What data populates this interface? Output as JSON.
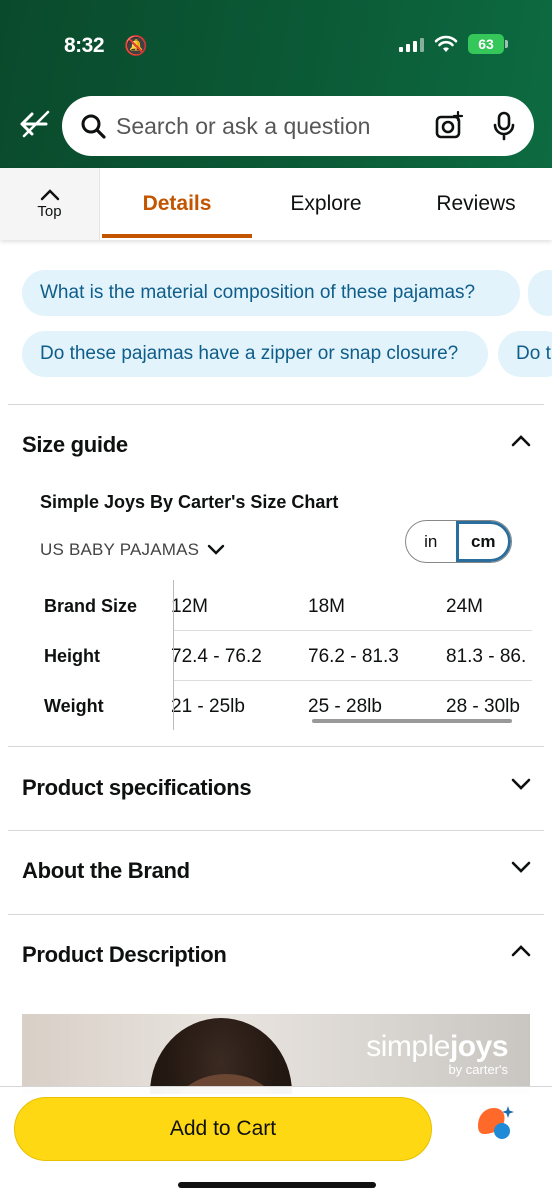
{
  "status_bar": {
    "time": "8:32",
    "battery": "63"
  },
  "search": {
    "placeholder": "Search or ask a question"
  },
  "tabs": {
    "top_label": "Top",
    "items": [
      "Details",
      "Explore",
      "Reviews"
    ],
    "active": "Details"
  },
  "questions": [
    "What is the material composition of these pajamas?",
    "Do these pajamas have a zipper or snap closure?",
    "Do t"
  ],
  "size_guide": {
    "title": "Size guide",
    "chart_title": "Simple Joys By Carter's Size Chart",
    "chart_category": "US BABY PAJAMAS",
    "units": [
      "in",
      "cm"
    ],
    "selected_unit": "cm",
    "rows": [
      {
        "label": "Brand Size",
        "cells": [
          "12M",
          "18M",
          "24M"
        ]
      },
      {
        "label": "Height",
        "cells": [
          "72.4 - 76.2",
          "76.2 - 81.3",
          "81.3 - 86."
        ]
      },
      {
        "label": "Weight",
        "cells": [
          "21 - 25lb",
          "25 - 28lb",
          "28 - 30lb"
        ]
      }
    ]
  },
  "sections": {
    "specs": "Product specifications",
    "brand": "About the Brand",
    "description": "Product Description"
  },
  "product_image": {
    "logo_line1_a": "simple",
    "logo_line1_b": "joys",
    "logo_line2": "by carter's"
  },
  "cart": {
    "label": "Add to Cart"
  },
  "colors": {
    "accent": "#c45500",
    "chip_bg": "#e2f3fb",
    "chip_text": "#0f5d8a",
    "cart": "#ffd814",
    "header": "#0b5a36"
  }
}
